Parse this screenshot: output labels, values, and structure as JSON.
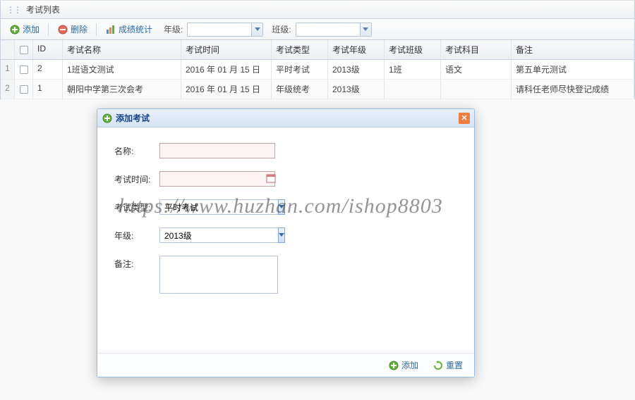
{
  "panel": {
    "title": "考试列表"
  },
  "toolbar": {
    "add": "添加",
    "delete": "删除",
    "stats": "成绩统计",
    "gradeLabel": "年级:",
    "classLabel": "班级:"
  },
  "grid": {
    "headers": {
      "id": "ID",
      "name": "考试名称",
      "time": "考试时间",
      "type": "考试类型",
      "grade": "考试年级",
      "class": "考试班级",
      "subject": "考试科目",
      "remark": "备注"
    },
    "rows": [
      {
        "rn": "1",
        "id": "2",
        "name": "1班语文测试",
        "time": "2016 年 01 月 15 日",
        "type": "平时考试",
        "grade": "2013级",
        "class": "1班",
        "subject": "语文",
        "remark": "第五单元测试"
      },
      {
        "rn": "2",
        "id": "1",
        "name": "朝阳中学第三次会考",
        "time": "2016 年 01 月 15 日",
        "type": "年级统考",
        "grade": "2013级",
        "class": "",
        "subject": "",
        "remark": "请科任老师尽快登记成绩"
      }
    ]
  },
  "dialog": {
    "title": "添加考试",
    "fields": {
      "nameLabel": "名称:",
      "timeLabel": "考试时间:",
      "typeLabel": "考试类型:",
      "typeValue": "平时考试",
      "gradeLabel": "年级:",
      "gradeValue": "2013级",
      "remarkLabel": "备注:"
    },
    "buttons": {
      "add": "添加",
      "reset": "重置"
    }
  },
  "watermark": "https://www.huzhan.com/ishop8803"
}
